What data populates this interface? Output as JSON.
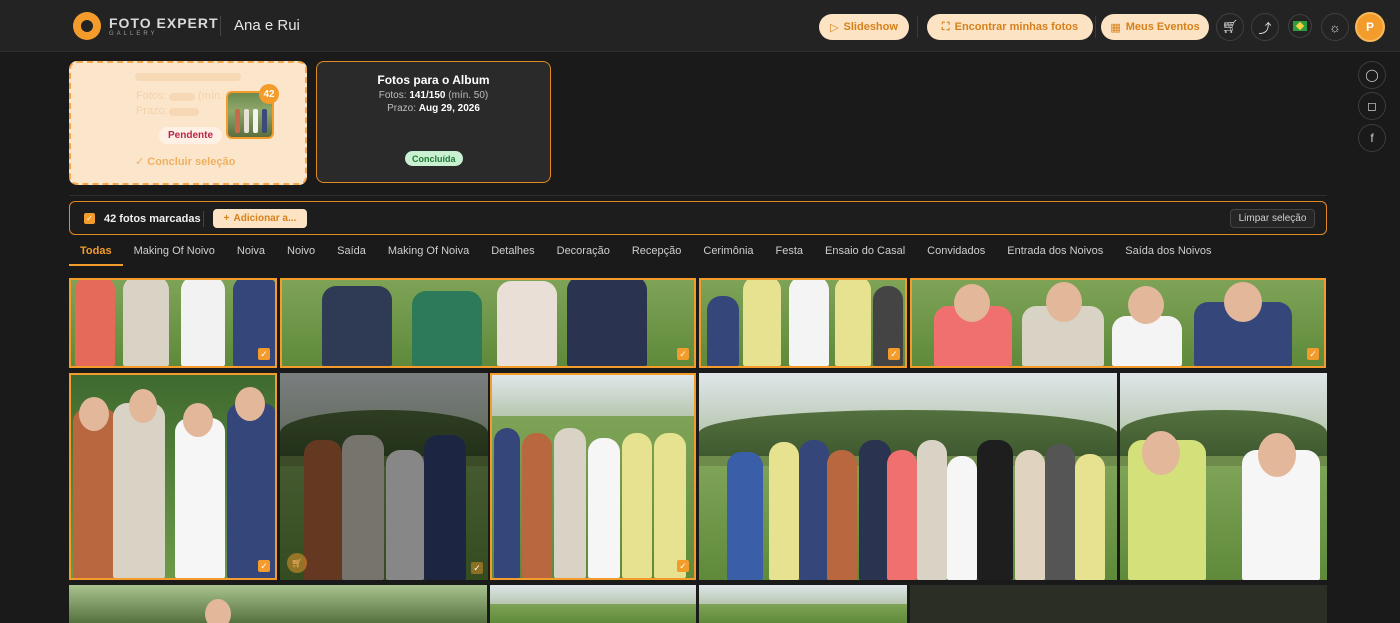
{
  "header": {
    "brand": "FOTO EXPERT",
    "brand_sub": "GALLERY",
    "event_title": "Ana e Rui",
    "slideshow_label": "Slideshow",
    "find_photos_label": "Encontrar minhas fotos",
    "events_label": "Meus Eventos",
    "avatar_initial": "P",
    "icons": [
      "cart-icon",
      "share-icon",
      "brazil-flag-icon",
      "sun-icon"
    ]
  },
  "rail": {
    "icons": [
      "chat-icon",
      "instagram-icon",
      "facebook-icon"
    ]
  },
  "selection_card": {
    "photos_label": "Fotos:",
    "min_label": "(mín. 5",
    "deadline_label": "Prazo:",
    "status": "Pendente",
    "count_badge": "42",
    "finish_label": "Concluir seleção"
  },
  "album_card": {
    "title": "Fotos para o Album",
    "photos_label": "Fotos:",
    "photos_value": "141/150",
    "min_label": "(mín. 50)",
    "deadline_label": "Prazo:",
    "deadline_value": "Aug 29, 2026",
    "status": "Concluída"
  },
  "selection_bar": {
    "selected_count": "42 fotos marcadas",
    "add_label": "Adicionar a...",
    "clear_label": "Limpar seleção"
  },
  "tabs": [
    {
      "label": "Todas",
      "active": true
    },
    {
      "label": "Making Of Noivo"
    },
    {
      "label": "Noiva"
    },
    {
      "label": "Noivo"
    },
    {
      "label": "Saída"
    },
    {
      "label": "Making Of Noiva"
    },
    {
      "label": "Detalhes"
    },
    {
      "label": "Decoração"
    },
    {
      "label": "Recepção"
    },
    {
      "label": "Cerimônia"
    },
    {
      "label": "Festa"
    },
    {
      "label": "Ensaio do Casal"
    },
    {
      "label": "Convidados"
    },
    {
      "label": "Entrada dos Noivos"
    },
    {
      "label": "Saída dos Noivos"
    }
  ],
  "colors": {
    "accent": "#f39c2b",
    "pending": "#b8264a",
    "done": "#1f7a37"
  }
}
